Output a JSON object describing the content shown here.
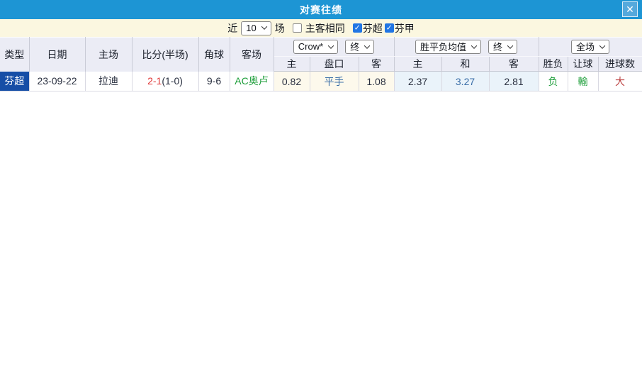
{
  "icons": {
    "check": "✓",
    "close": "✕"
  },
  "colors": {
    "title_bar": "#1d95d4",
    "close_button": "#55a9dc",
    "filter_bar_bg": "#fbf7e0",
    "header_bg": "#ebecf5",
    "league_cell_bg": "#164ea6",
    "handicap_cols_bg": "#fdf9ec",
    "odds_cols_bg": "#eaf3fa",
    "checkbox_checked": "#2176e4",
    "score_red": "#e03434",
    "goals_red": "#bb3e3e",
    "green": "#1d9e3a",
    "blue_text": "#3a6ea8"
  },
  "title_bar": {
    "title": "对赛往绩"
  },
  "filter_bar": {
    "recent_label": "近",
    "recent_count": "10",
    "unit_label": "场",
    "checkboxes": [
      {
        "label": "主客相同",
        "checked": false
      },
      {
        "label": "芬超",
        "checked": true
      },
      {
        "label": "芬甲",
        "checked": true
      }
    ]
  },
  "selects": {
    "bookmaker": "Crow*",
    "handicap_time": "终",
    "odds_mode": "胜平负均值",
    "odds_time": "终",
    "scope": "全场"
  },
  "table": {
    "main_headers": [
      "类型",
      "日期",
      "主场",
      "比分(半场)",
      "角球",
      "客场"
    ],
    "sub_headers": [
      "主",
      "盘口",
      "客",
      "主",
      "和",
      "客",
      "胜负",
      "让球",
      "进球数"
    ],
    "rows": [
      {
        "league": "芬超",
        "date": "23-09-22",
        "home": "拉迪",
        "score": "2-1",
        "half": "(1-0)",
        "corners": "9-6",
        "away": "AC奥卢",
        "ah_home": "0.82",
        "ah_line": "平手",
        "ah_away": "1.08",
        "odds_home": "2.37",
        "odds_draw": "3.27",
        "odds_away": "2.81",
        "result": "负",
        "ah_result": "輸",
        "goal_total": "大"
      }
    ]
  }
}
